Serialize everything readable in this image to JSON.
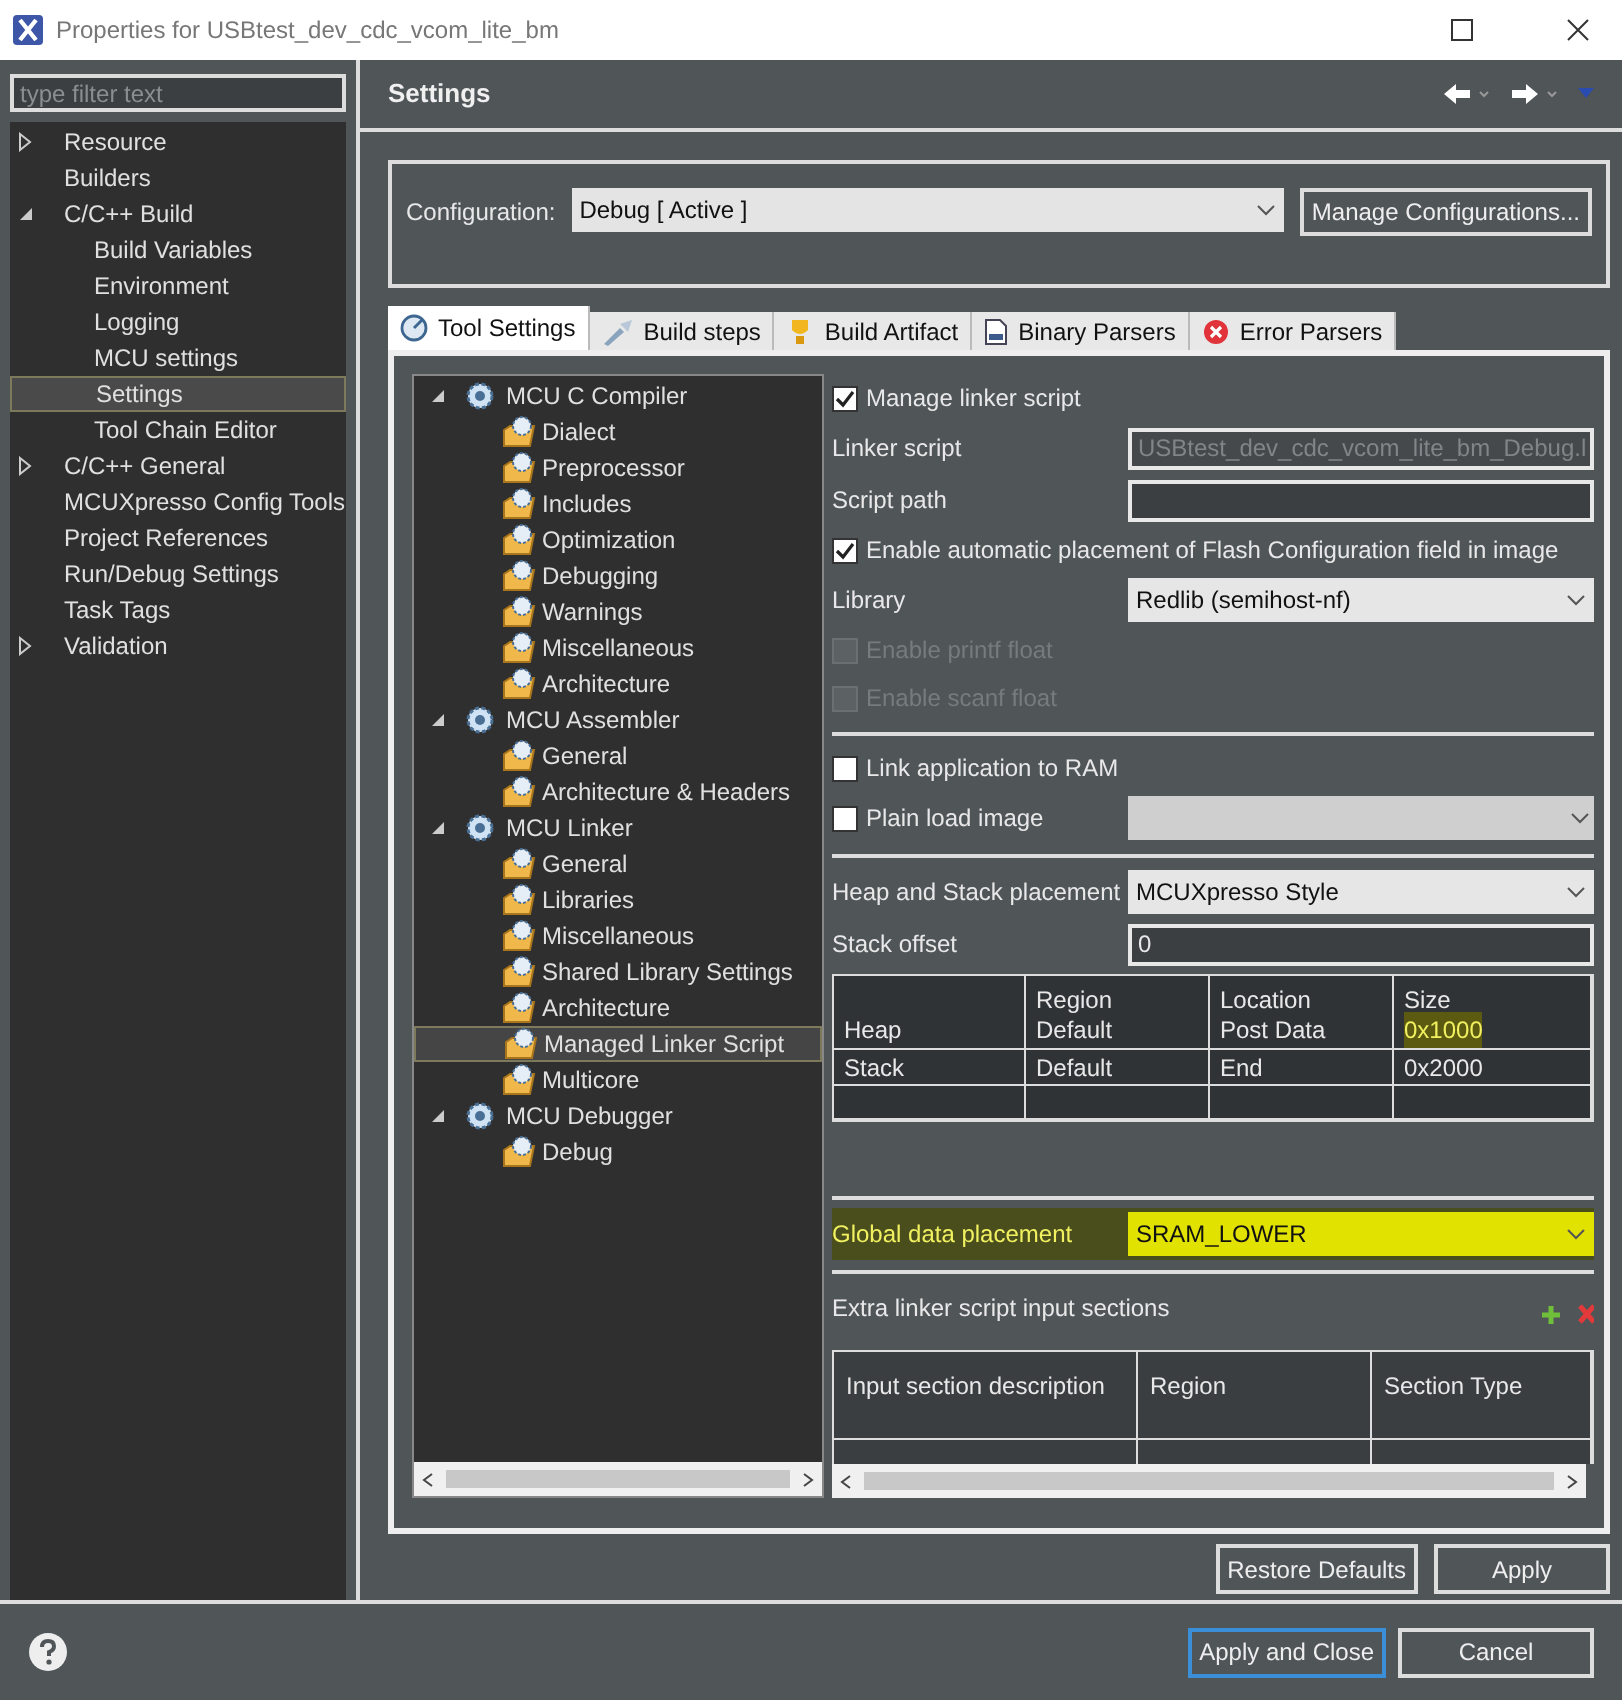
{
  "window": {
    "title": "Properties for USBtest_dev_cdc_vcom_lite_bm"
  },
  "filter": {
    "placeholder": "type filter text"
  },
  "sidebar": {
    "items": [
      {
        "label": "Resource",
        "kind": "group",
        "expanded": false,
        "selected": false
      },
      {
        "label": "Builders",
        "kind": "page",
        "selected": false
      },
      {
        "label": "C/C++ Build",
        "kind": "group",
        "expanded": true,
        "selected": false,
        "children": [
          {
            "label": "Build Variables",
            "selected": false
          },
          {
            "label": "Environment",
            "selected": false
          },
          {
            "label": "Logging",
            "selected": false
          },
          {
            "label": "MCU settings",
            "selected": false
          },
          {
            "label": "Settings",
            "selected": true
          },
          {
            "label": "Tool Chain Editor",
            "selected": false
          }
        ]
      },
      {
        "label": "C/C++ General",
        "kind": "group",
        "expanded": false,
        "selected": false
      },
      {
        "label": "MCUXpresso Config Tools",
        "kind": "page",
        "selected": false
      },
      {
        "label": "Project References",
        "kind": "page",
        "selected": false
      },
      {
        "label": "Run/Debug Settings",
        "kind": "page",
        "selected": false
      },
      {
        "label": "Task Tags",
        "kind": "page",
        "selected": false
      },
      {
        "label": "Validation",
        "kind": "group",
        "expanded": false,
        "selected": false
      }
    ]
  },
  "page_title": "Settings",
  "configuration": {
    "label": "Configuration:",
    "value": "Debug  [ Active ]",
    "button": "Manage Configurations..."
  },
  "tabs": [
    {
      "label": "Tool Settings",
      "kind": "tool",
      "selected": true
    },
    {
      "label": "Build steps",
      "kind": "steps",
      "selected": false
    },
    {
      "label": "Build Artifact",
      "kind": "artifact",
      "selected": false
    },
    {
      "label": "Binary Parsers",
      "kind": "binary",
      "selected": false
    },
    {
      "label": "Error Parsers",
      "kind": "error",
      "selected": false
    }
  ],
  "tools": [
    {
      "label": "MCU C Compiler",
      "expanded": true,
      "children": [
        {
          "label": "Dialect",
          "selected": false
        },
        {
          "label": "Preprocessor",
          "selected": false
        },
        {
          "label": "Includes",
          "selected": false
        },
        {
          "label": "Optimization",
          "selected": false
        },
        {
          "label": "Debugging",
          "selected": false
        },
        {
          "label": "Warnings",
          "selected": false
        },
        {
          "label": "Miscellaneous",
          "selected": false
        },
        {
          "label": "Architecture",
          "selected": false
        }
      ]
    },
    {
      "label": "MCU Assembler",
      "expanded": true,
      "children": [
        {
          "label": "General",
          "selected": false
        },
        {
          "label": "Architecture & Headers",
          "selected": false
        }
      ]
    },
    {
      "label": "MCU Linker",
      "expanded": true,
      "children": [
        {
          "label": "General",
          "selected": false
        },
        {
          "label": "Libraries",
          "selected": false
        },
        {
          "label": "Miscellaneous",
          "selected": false
        },
        {
          "label": "Shared Library Settings",
          "selected": false
        },
        {
          "label": "Architecture",
          "selected": false
        },
        {
          "label": "Managed Linker Script",
          "selected": true
        },
        {
          "label": "Multicore",
          "selected": false
        }
      ]
    },
    {
      "label": "MCU Debugger",
      "expanded": true,
      "children": [
        {
          "label": "Debug",
          "selected": false
        }
      ]
    }
  ],
  "form_sections": [
    [
      {
        "kind": "checkbox",
        "label": "Manage linker script",
        "checked": true,
        "disabled": false
      },
      {
        "kind": "field",
        "label": "Linker script",
        "value": "USBtest_dev_cdc_vcom_lite_bm_Debug.l",
        "disabled": true
      },
      {
        "kind": "field",
        "label": "Script path"
      },
      {
        "kind": "checkbox",
        "label": "Enable automatic placement of Flash Configuration field in image",
        "checked": true,
        "disabled": false
      },
      {
        "kind": "select",
        "label": "Library",
        "value": "Redlib (semihost-nf)",
        "highlighted": false
      },
      {
        "kind": "checkbox",
        "label": "Enable printf float",
        "checked": false,
        "disabled": true
      },
      {
        "kind": "checkbox",
        "label": "Enable scanf float",
        "checked": false,
        "disabled": true
      }
    ],
    [
      {
        "kind": "checkbox",
        "label": "Link application to RAM",
        "checked": false,
        "disabled": false
      },
      {
        "kind": "checkbox_select",
        "label": "Plain load image",
        "checked": false,
        "disabled": true
      }
    ],
    [
      {
        "kind": "select",
        "label": "Heap and Stack placement",
        "value": "MCUXpresso Style",
        "highlighted": false
      },
      {
        "kind": "field",
        "label": "Stack offset",
        "value": "0"
      },
      {
        "kind": "table",
        "columns": [
          "",
          "Region",
          "Location",
          "Size"
        ],
        "rows": [
          [
            {
              "text": "Heap",
              "highlighted": false
            },
            {
              "text": "Default",
              "highlighted": false
            },
            {
              "text": "Post Data",
              "highlighted": false
            },
            {
              "text": "0x1000",
              "highlighted": true
            }
          ],
          [
            {
              "text": "Stack",
              "highlighted": false
            },
            {
              "text": "Default",
              "highlighted": false
            },
            {
              "text": "End",
              "highlighted": false
            },
            {
              "text": "0x2000",
              "highlighted": false
            }
          ]
        ]
      }
    ],
    [
      {
        "kind": "select",
        "label": "Global data placement",
        "value": "SRAM_LOWER",
        "highlighted": true
      }
    ],
    [
      {
        "kind": "heading",
        "label": "Extra linker script input sections"
      },
      {
        "kind": "table2",
        "columns": [
          "Input section description",
          "Region",
          "Section Type"
        ]
      }
    ]
  ],
  "buttons": {
    "restore": "Restore Defaults",
    "apply": "Apply",
    "apply_close": "Apply and Close",
    "cancel": "Cancel"
  }
}
